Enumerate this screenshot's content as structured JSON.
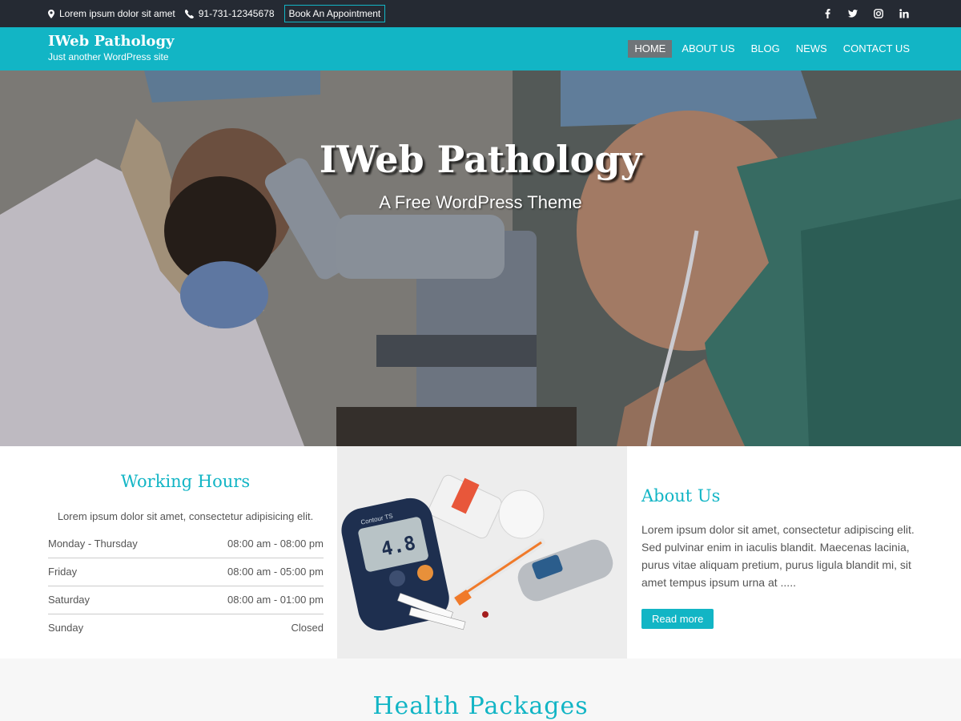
{
  "topbar": {
    "address": "Lorem ipsum dolor sit amet",
    "phone": "91-731-12345678",
    "appointment_label": "Book An Appointment",
    "social": [
      "facebook-icon",
      "twitter-icon",
      "instagram-icon",
      "linkedin-icon"
    ]
  },
  "header": {
    "site_title": "IWeb Pathology",
    "tagline": "Just another WordPress site",
    "nav": [
      "HOME",
      "ABOUT US",
      "BLOG",
      "NEWS",
      "CONTACT US"
    ],
    "active": "HOME"
  },
  "hero": {
    "title": "IWeb Pathology",
    "subtitle": "A Free WordPress Theme"
  },
  "hours": {
    "title": "Working Hours",
    "intro": "Lorem ipsum dolor sit amet, consectetur adipisicing elit.",
    "rows": [
      {
        "day": "Monday - Thursday",
        "time": "08:00 am - 08:00 pm"
      },
      {
        "day": "Friday",
        "time": "08:00 am - 05:00 pm"
      },
      {
        "day": "Saturday",
        "time": "08:00 am - 01:00 pm"
      },
      {
        "day": "Sunday",
        "time": "Closed"
      }
    ]
  },
  "photo": {
    "meter_brand": "Contour TS",
    "meter_reading": "4.8"
  },
  "about": {
    "title": "About Us",
    "text": "Lorem ipsum dolor sit amet, consectetur adipiscing elit. Sed pulvinar enim in iaculis blandit. Maecenas lacinia, purus vitae aliquam pretium, purus ligula blandit mi, sit amet tempus ipsum urna at .....",
    "button": "Read more"
  },
  "packages": {
    "title": "Health Packages"
  },
  "colors": {
    "accent": "#12b5c5",
    "topbar": "#252a33",
    "nav_active": "#6f7478"
  }
}
